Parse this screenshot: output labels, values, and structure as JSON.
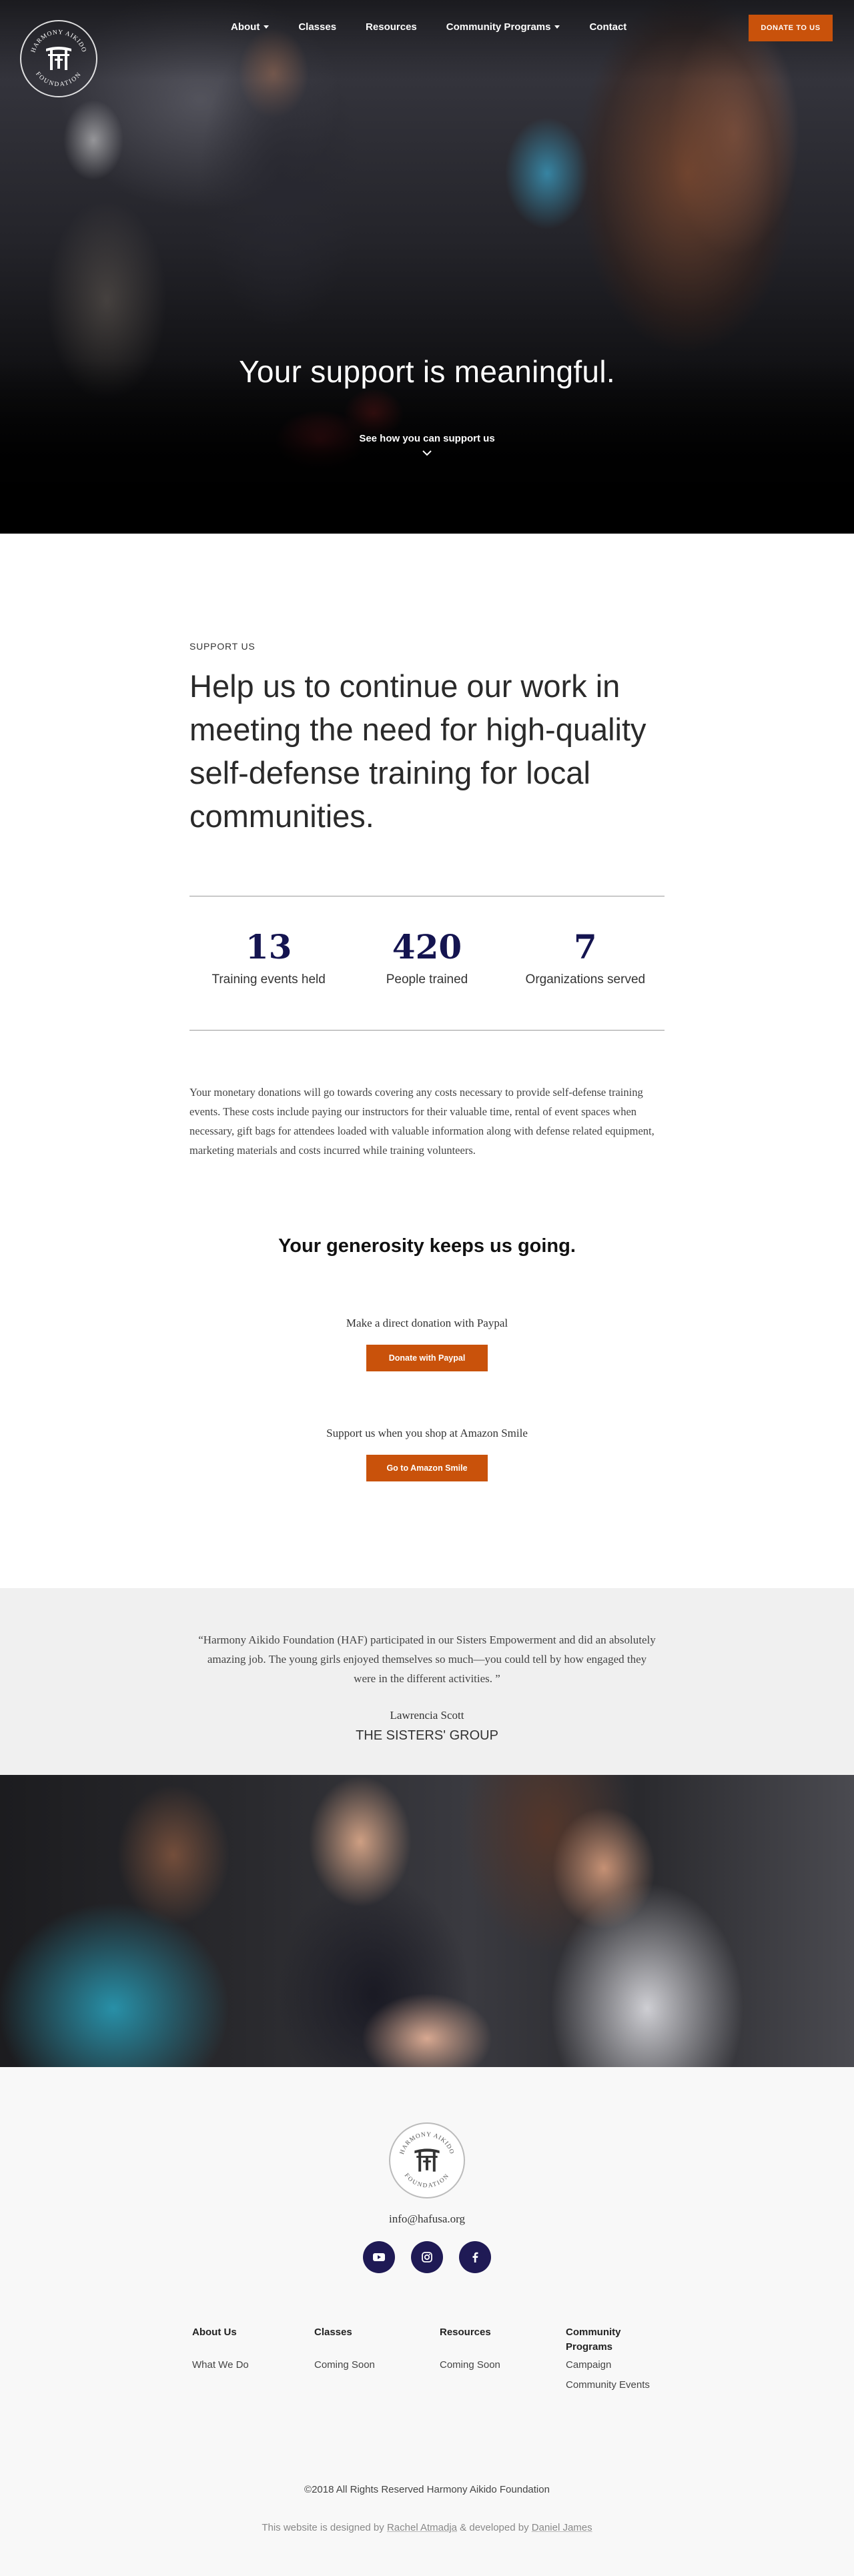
{
  "logo": {
    "text_top": "HARMONY AIKIDO",
    "text_bottom": "FOUNDATION"
  },
  "nav": {
    "items": [
      {
        "label": "About",
        "has_dropdown": true
      },
      {
        "label": "Classes",
        "has_dropdown": false
      },
      {
        "label": "Resources",
        "has_dropdown": false
      },
      {
        "label": "Community Programs",
        "has_dropdown": true
      },
      {
        "label": "Contact",
        "has_dropdown": false
      }
    ],
    "donate_label": "DONATE TO US"
  },
  "hero": {
    "title": "Your support is meaningful.",
    "link": "See how you can support us",
    "chevron_icon": "chevron-down-icon"
  },
  "support": {
    "eyebrow": "SUPPORT US",
    "headline": "Help us to continue our work in meeting the need for high-quality self-defense training for local communities.",
    "stats": [
      {
        "number": "13",
        "label": "Training events held"
      },
      {
        "number": "420",
        "label": "People trained"
      },
      {
        "number": "7",
        "label": "Organizations served"
      }
    ],
    "body": "Your monetary donations will go towards covering any costs necessary to provide self-defense training events. These costs include paying our instructors for their valuable time, rental of event spaces when necessary, gift bags for attendees loaded with valuable information along with defense related equipment, marketing materials and costs incurred while training volunteers.",
    "generosity": "Your generosity keeps us going.",
    "paypal_label": "Make a direct donation with Paypal",
    "paypal_button": "Donate with Paypal",
    "amazon_label": "Support us when you shop at Amazon Smile",
    "amazon_button": "Go to Amazon Smile",
    "accent_color": "#c9520b",
    "stat_color": "#141450"
  },
  "testimonial": {
    "quote": "“Harmony Aikido Foundation (HAF) participated in our Sisters Empowerment and did an absolutely amazing job. The young girls enjoyed themselves so much—you could tell by how engaged they were in the different activities. ”",
    "author": "Lawrencia Scott",
    "organization": "THE SISTERS' GROUP"
  },
  "footer": {
    "email": "info@hafusa.org",
    "socials": [
      {
        "icon": "youtube-icon"
      },
      {
        "icon": "instagram-icon"
      },
      {
        "icon": "facebook-icon"
      }
    ],
    "columns": [
      {
        "heading": "About Us",
        "links": [
          "What We Do"
        ]
      },
      {
        "heading": "Classes",
        "links": [
          "Coming Soon"
        ]
      },
      {
        "heading": "Resources",
        "links": [
          "Coming Soon"
        ]
      },
      {
        "heading": "Community Programs",
        "links": [
          "Campaign",
          "Community Events"
        ]
      }
    ],
    "copyright": "©2018  All Rights Reserved  Harmony Aikido Foundation",
    "credits_prefix": "This website is designed by ",
    "designer": "Rachel Atmadja",
    "credits_middle": " & developed by ",
    "developer": "Daniel James",
    "social_color": "#1f1a55"
  }
}
